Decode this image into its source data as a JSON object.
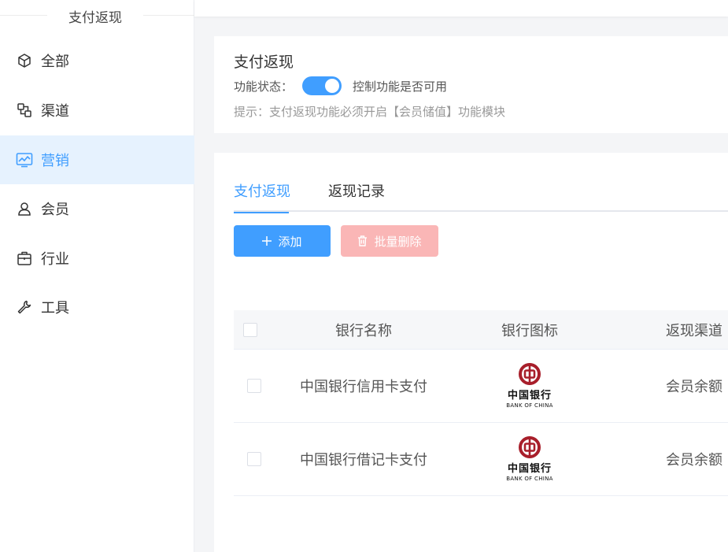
{
  "sidebar": {
    "title": "支付返现",
    "items": [
      {
        "label": "全部",
        "icon": "cube-icon",
        "active": false
      },
      {
        "label": "渠道",
        "icon": "channel-icon",
        "active": false
      },
      {
        "label": "营销",
        "icon": "marketing-chart-icon",
        "active": true
      },
      {
        "label": "会员",
        "icon": "member-icon",
        "active": false
      },
      {
        "label": "行业",
        "icon": "briefcase-icon",
        "active": false
      },
      {
        "label": "工具",
        "icon": "wrench-icon",
        "active": false
      }
    ]
  },
  "info": {
    "title": "支付返现",
    "status_label": "功能状态：",
    "status_enabled": true,
    "status_desc": "控制功能是否可用",
    "hint": "提示：支付返现功能必须开启【会员储值】功能模块"
  },
  "tabs": [
    {
      "label": "支付返现",
      "active": true
    },
    {
      "label": "返现记录",
      "active": false
    }
  ],
  "buttons": {
    "add": "添加",
    "batch_delete": "批量删除"
  },
  "table": {
    "headers": {
      "name": "银行名称",
      "icon": "银行图标",
      "channel": "返现渠道"
    },
    "rows": [
      {
        "name": "中国银行信用卡支付",
        "logo_cn": "中国银行",
        "logo_en": "BANK OF CHINA",
        "channel": "会员余额"
      },
      {
        "name": "中国银行借记卡支付",
        "logo_cn": "中国银行",
        "logo_en": "BANK OF CHINA",
        "channel": "会员余额"
      }
    ]
  },
  "colors": {
    "accent": "#409eff",
    "danger_disabled": "#fab6b6",
    "bank_red": "#a81f2b"
  }
}
